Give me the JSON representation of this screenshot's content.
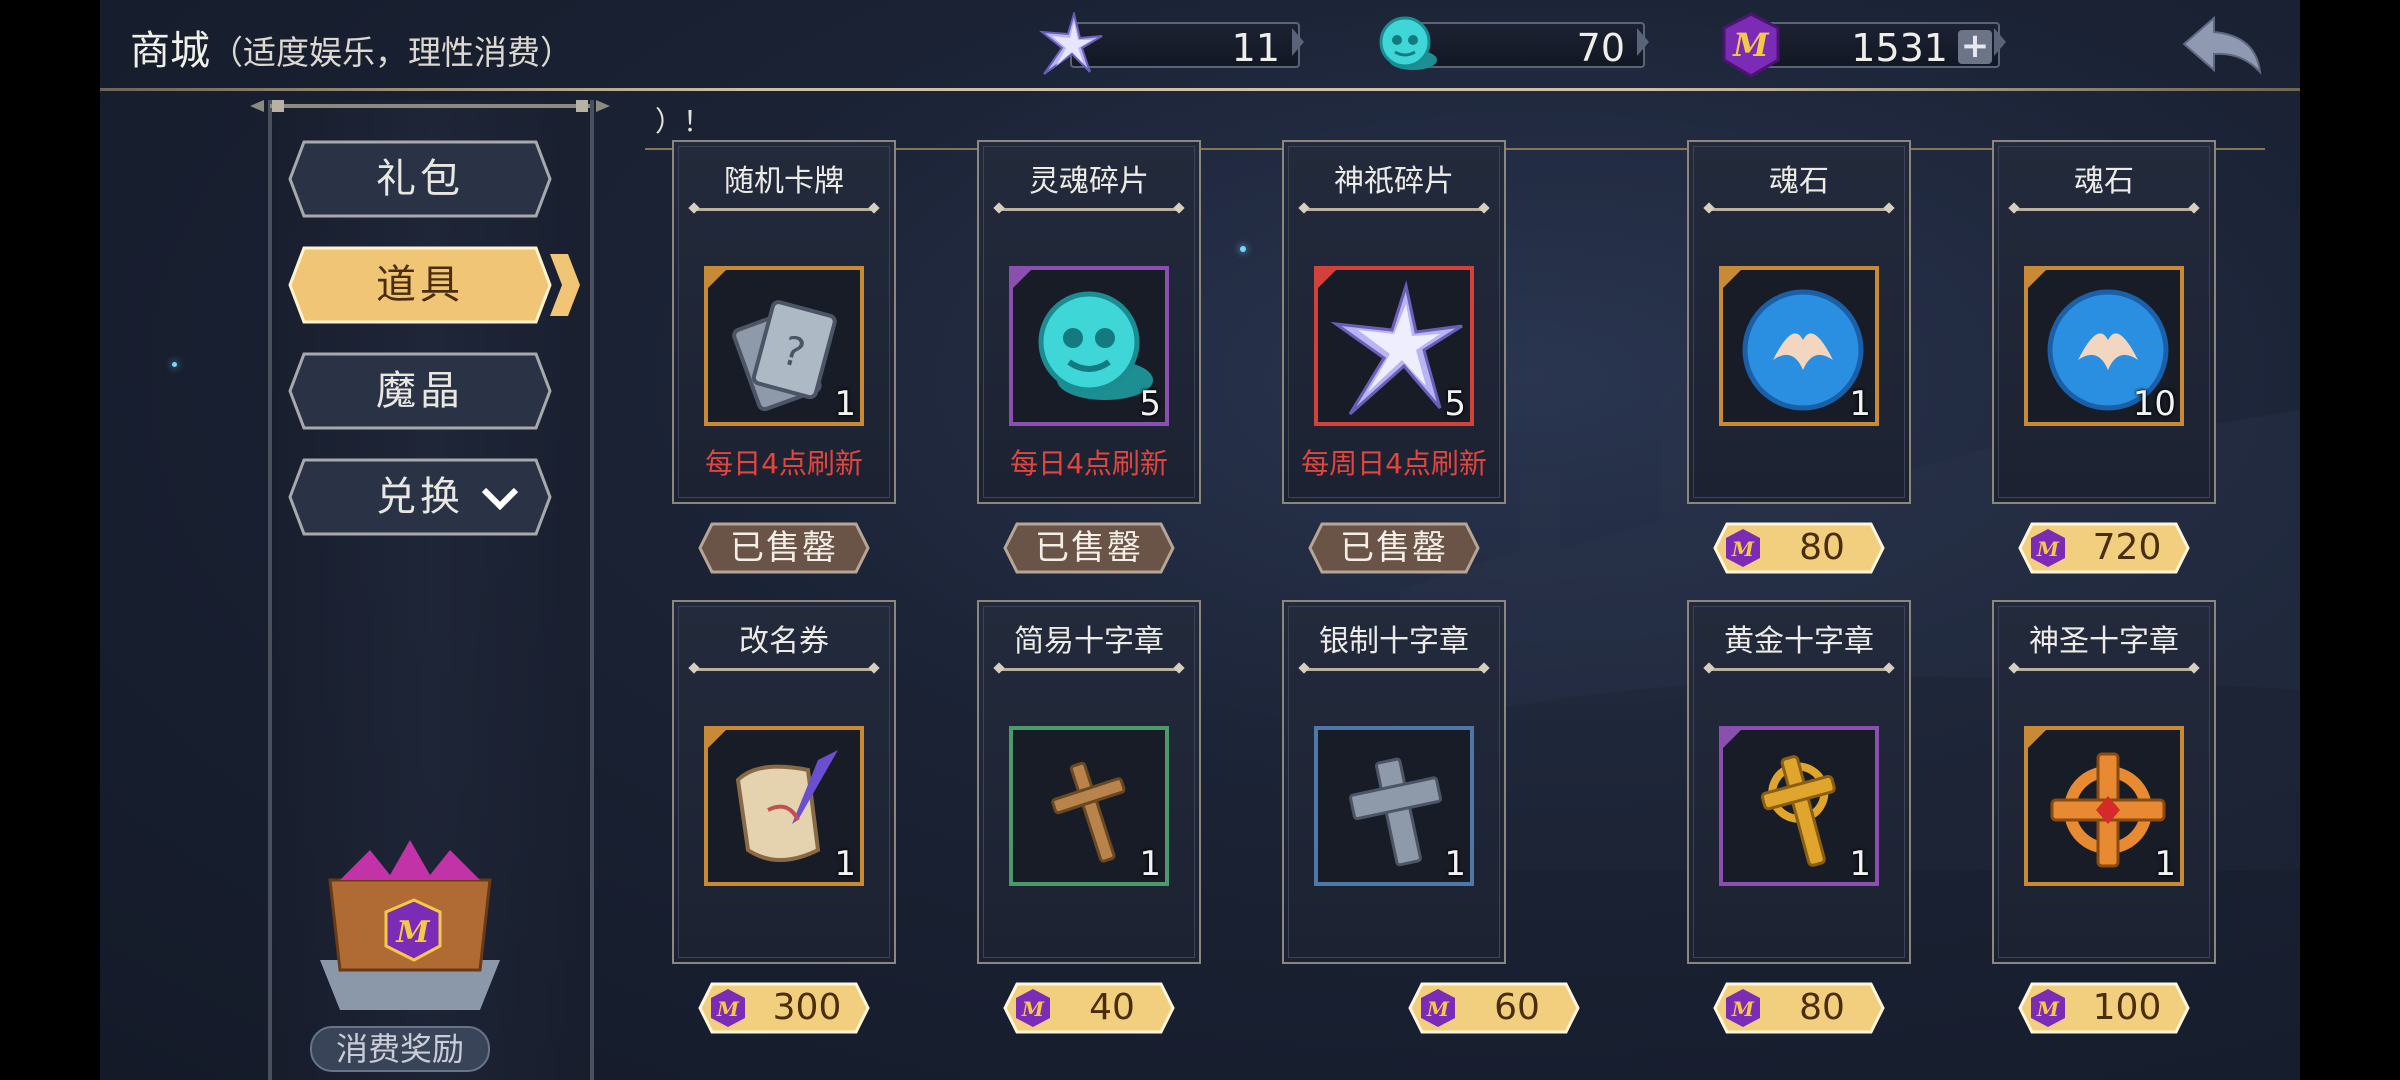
{
  "header": {
    "title": "商城",
    "subtitle": "（适度娱乐，理性消费）",
    "resources": [
      {
        "icon": "star-shard-icon",
        "value": "11"
      },
      {
        "icon": "soul-fragment-icon",
        "value": "70"
      },
      {
        "icon": "magic-crystal-icon",
        "value": "1531"
      }
    ]
  },
  "sidebar": {
    "tabs": [
      {
        "label": "礼包",
        "active": false
      },
      {
        "label": "道具",
        "active": true
      },
      {
        "label": "魔晶",
        "active": false
      },
      {
        "label": "兑换",
        "active": false
      }
    ],
    "reward_label": "消费奖励"
  },
  "notice": "）！",
  "items_row1": [
    {
      "name": "随机卡牌",
      "qty": "1",
      "refresh": "每日4点刷新",
      "status": "已售罄"
    },
    {
      "name": "灵魂碎片",
      "qty": "5",
      "refresh": "每日4点刷新",
      "status": "已售罄"
    },
    {
      "name": "神祇碎片",
      "qty": "5",
      "refresh": "每周日4点刷新",
      "status": "已售罄"
    },
    {
      "name": "魂石",
      "qty": "1",
      "price": "80"
    },
    {
      "name": "魂石",
      "qty": "10",
      "price": "720"
    }
  ],
  "items_row2": [
    {
      "name": "改名券",
      "qty": "1",
      "price": "300"
    },
    {
      "name": "简易十字章",
      "qty": "1",
      "price": "40"
    },
    {
      "name": "银制十字章",
      "qty": "1",
      "price": "60"
    },
    {
      "name": "黄金十字章",
      "qty": "1",
      "price": "80"
    },
    {
      "name": "神圣十字章",
      "qty": "1",
      "price": "100"
    }
  ],
  "colors": {
    "accent_gold": "#f2cf7e",
    "refresh_red": "#e2453d",
    "crystal_purple": "#7b2bb5"
  }
}
